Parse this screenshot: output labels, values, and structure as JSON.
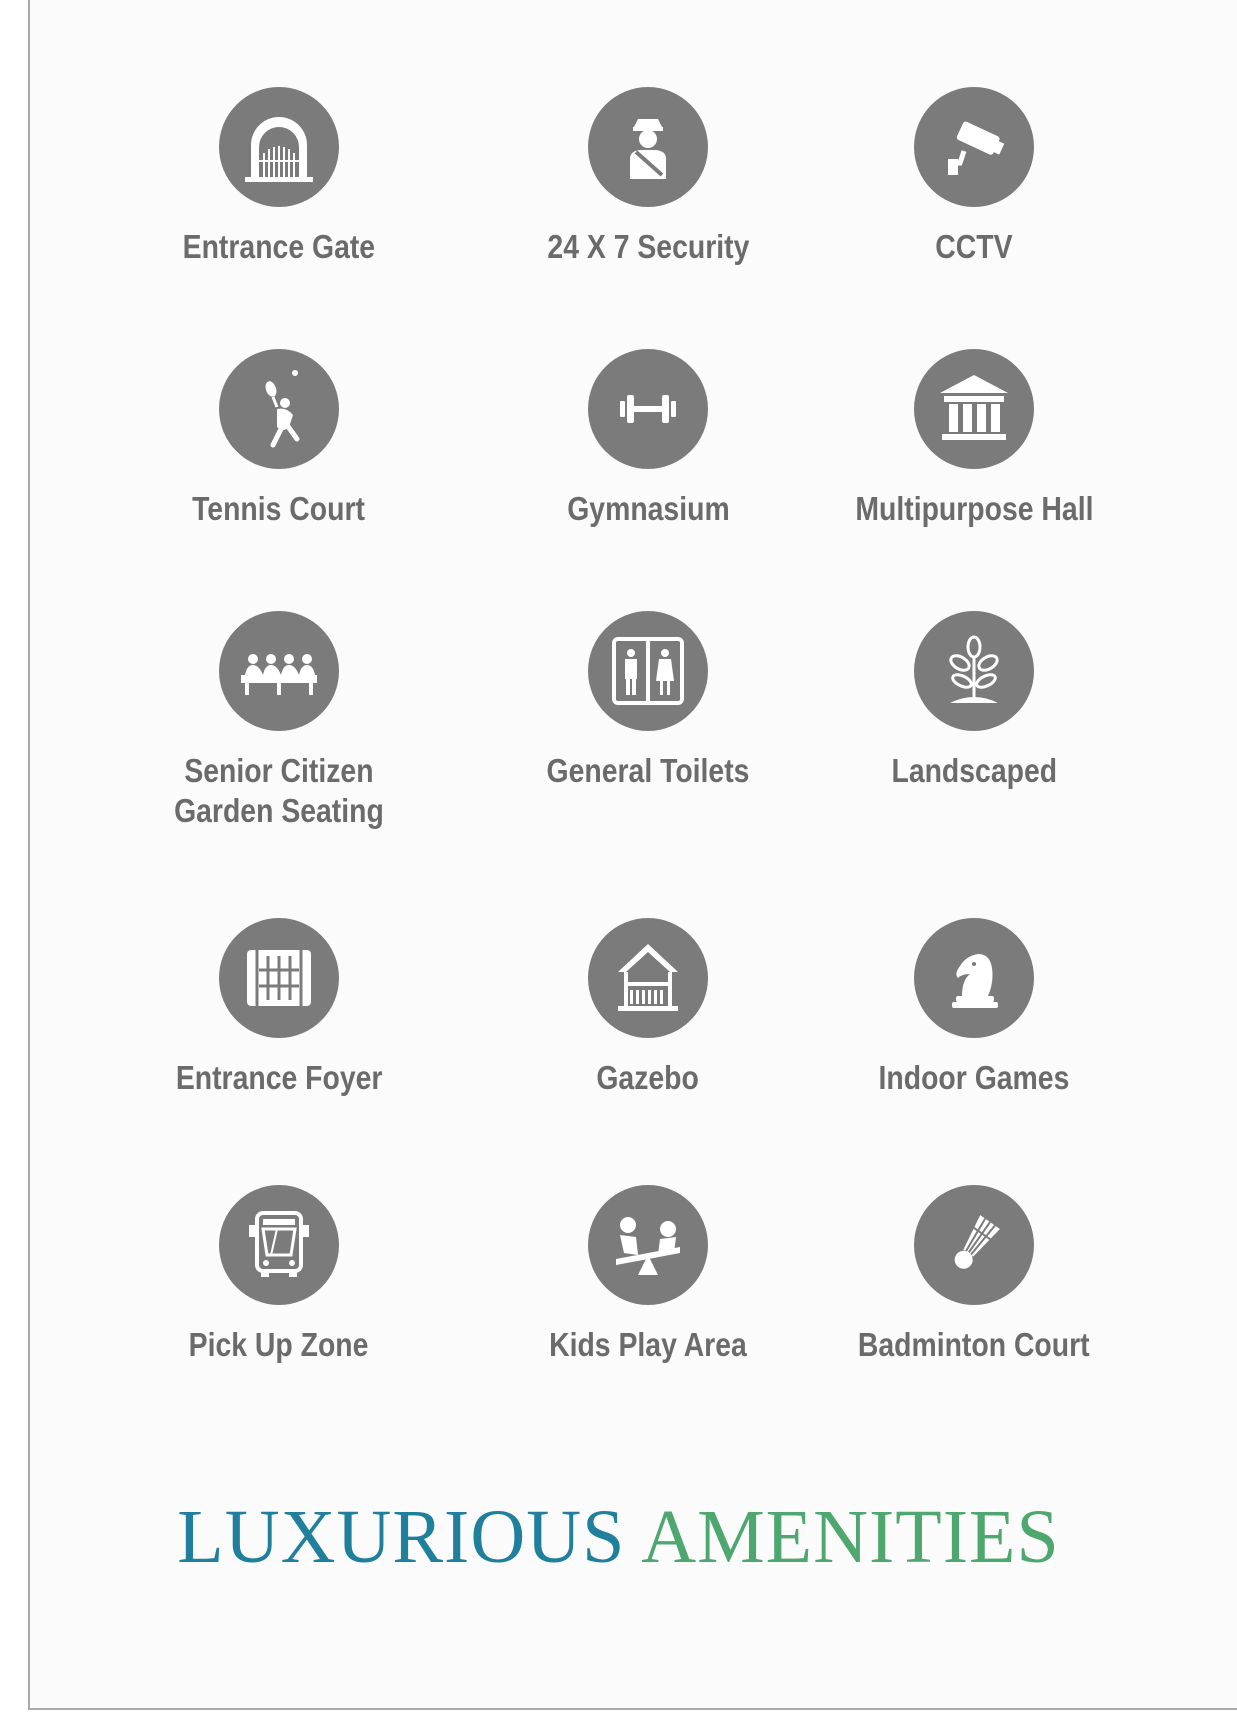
{
  "amenities": [
    {
      "label": "Entrance Gate",
      "icon": "entrance-gate-icon"
    },
    {
      "label": "24 X 7 Security",
      "icon": "security-guard-icon"
    },
    {
      "label": "CCTV",
      "icon": "cctv-camera-icon"
    },
    {
      "label": "Tennis Court",
      "icon": "tennis-player-icon"
    },
    {
      "label": "Gymnasium",
      "icon": "dumbbell-icon"
    },
    {
      "label": "Multipurpose Hall",
      "icon": "hall-building-icon"
    },
    {
      "label": "Senior Citizen Garden Seating",
      "label_lines": [
        "Senior Citizen",
        "Garden Seating"
      ],
      "icon": "garden-seating-icon"
    },
    {
      "label": "General Toilets",
      "icon": "toilets-icon"
    },
    {
      "label": "Landscaped",
      "icon": "plant-icon"
    },
    {
      "label": "Entrance Foyer",
      "icon": "foyer-icon"
    },
    {
      "label": "Gazebo",
      "icon": "gazebo-icon"
    },
    {
      "label": "Indoor Games",
      "icon": "chess-knight-icon"
    },
    {
      "label": "Pick Up Zone",
      "icon": "bus-icon"
    },
    {
      "label": "Kids Play Area",
      "icon": "seesaw-icon"
    },
    {
      "label": "Badminton Court",
      "icon": "shuttlecock-icon"
    }
  ],
  "heading": {
    "word1": "LUXURIOUS",
    "word2": "AMENITIES"
  },
  "colors": {
    "icon_circle": "#7b7b7b",
    "label_text": "#6b6b6b",
    "heading_blue": "#1f7f9c",
    "heading_green": "#4fa770",
    "border": "#a9a9a9"
  }
}
